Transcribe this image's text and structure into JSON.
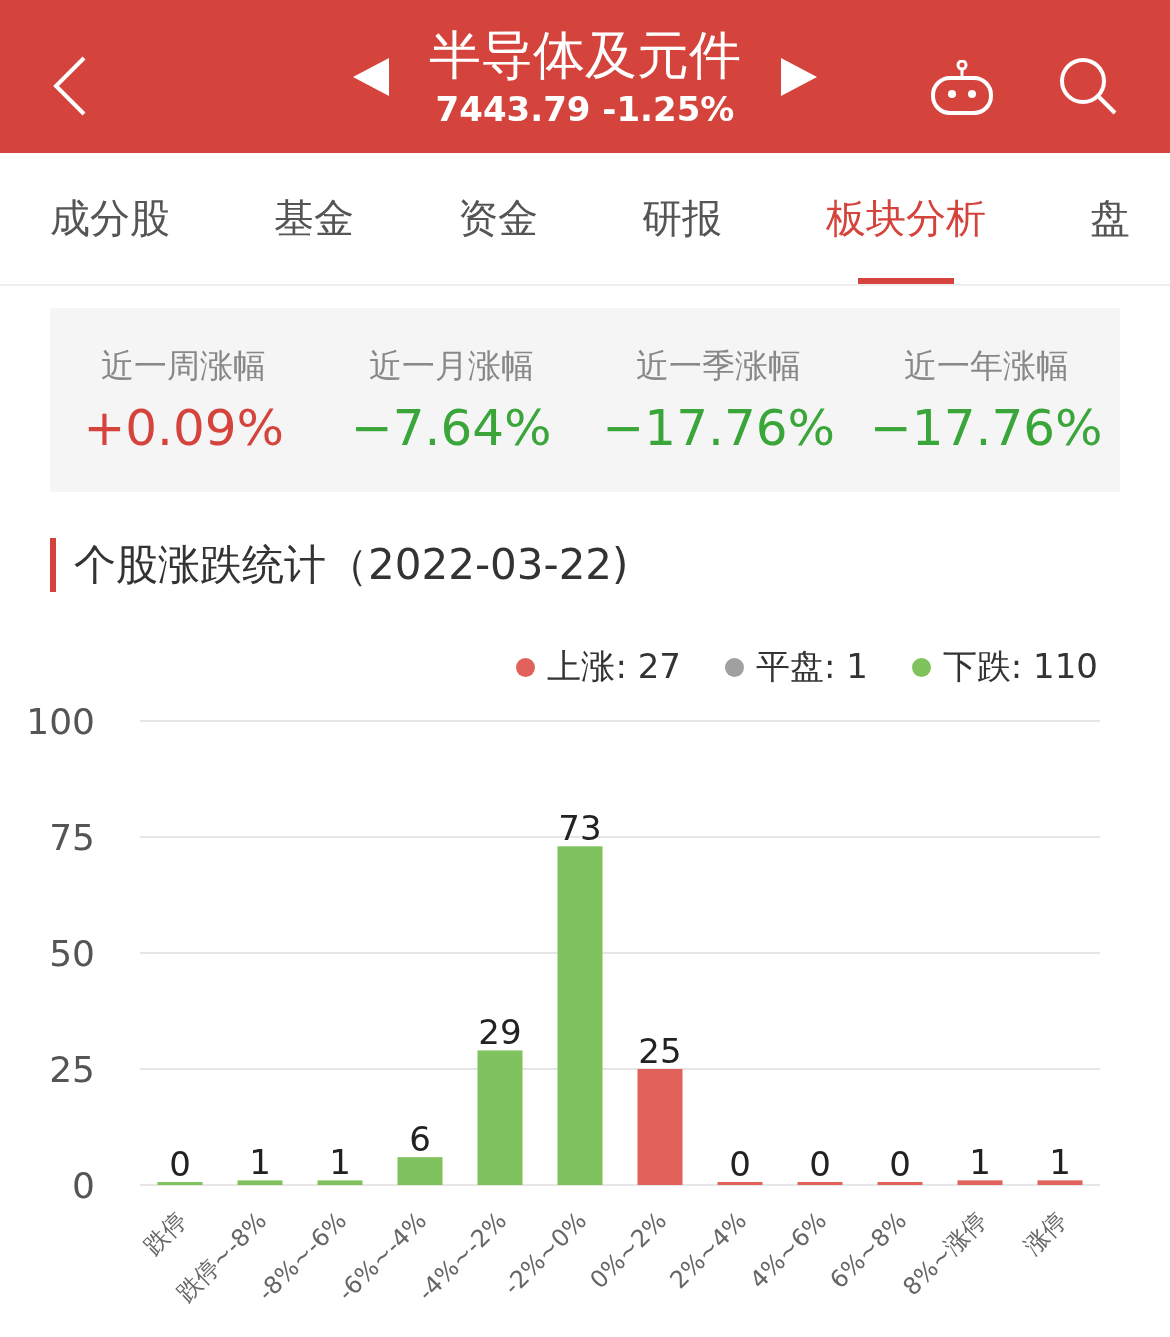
{
  "header": {
    "title": "半导体及元件",
    "quote": "7443.79 -1.25%"
  },
  "tabs": [
    {
      "label": "成分股",
      "selected": false
    },
    {
      "label": "基金",
      "selected": false
    },
    {
      "label": "资金",
      "selected": false
    },
    {
      "label": "研报",
      "selected": false
    },
    {
      "label": "板块分析",
      "selected": true
    },
    {
      "label": "盘",
      "selected": false
    }
  ],
  "performance": [
    {
      "label": "近一周涨幅",
      "value": "+0.09%",
      "color": "#d5443c"
    },
    {
      "label": "近一月涨幅",
      "value": "−7.64%",
      "color": "#3aa63a"
    },
    {
      "label": "近一季涨幅",
      "value": "−17.76%",
      "color": "#3aa63a"
    },
    {
      "label": "近一年涨幅",
      "value": "−17.76%",
      "color": "#3aa63a"
    }
  ],
  "section_title": "个股涨跌统计（2022-03-22)",
  "legend": [
    {
      "label": "上涨: 27",
      "color": "#e0625a"
    },
    {
      "label": "平盘: 1",
      "color": "#a0a0a0"
    },
    {
      "label": "下跌: 110",
      "color": "#80c35e"
    }
  ],
  "chart_data": {
    "type": "bar",
    "categories": [
      "跌停",
      "跌停~-8%",
      "-8%~-6%",
      "-6%~-4%",
      "-4%~-2%",
      "-2%~0%",
      "0%~2%",
      "2%~4%",
      "4%~6%",
      "6%~8%",
      "8%~涨停",
      "涨停"
    ],
    "series": [
      {
        "color": "#80c35e",
        "values": [
          0,
          1,
          1,
          6,
          29,
          73,
          null,
          null,
          null,
          null,
          null,
          null
        ]
      },
      {
        "color": "#e0625a",
        "values": [
          null,
          null,
          null,
          null,
          null,
          null,
          25,
          0,
          0,
          0,
          1,
          1
        ]
      }
    ],
    "ylim": [
      0,
      100
    ],
    "yticks": [
      0,
      25,
      50,
      75,
      100
    ],
    "stacked": true,
    "grid": true,
    "data_labels": true
  }
}
